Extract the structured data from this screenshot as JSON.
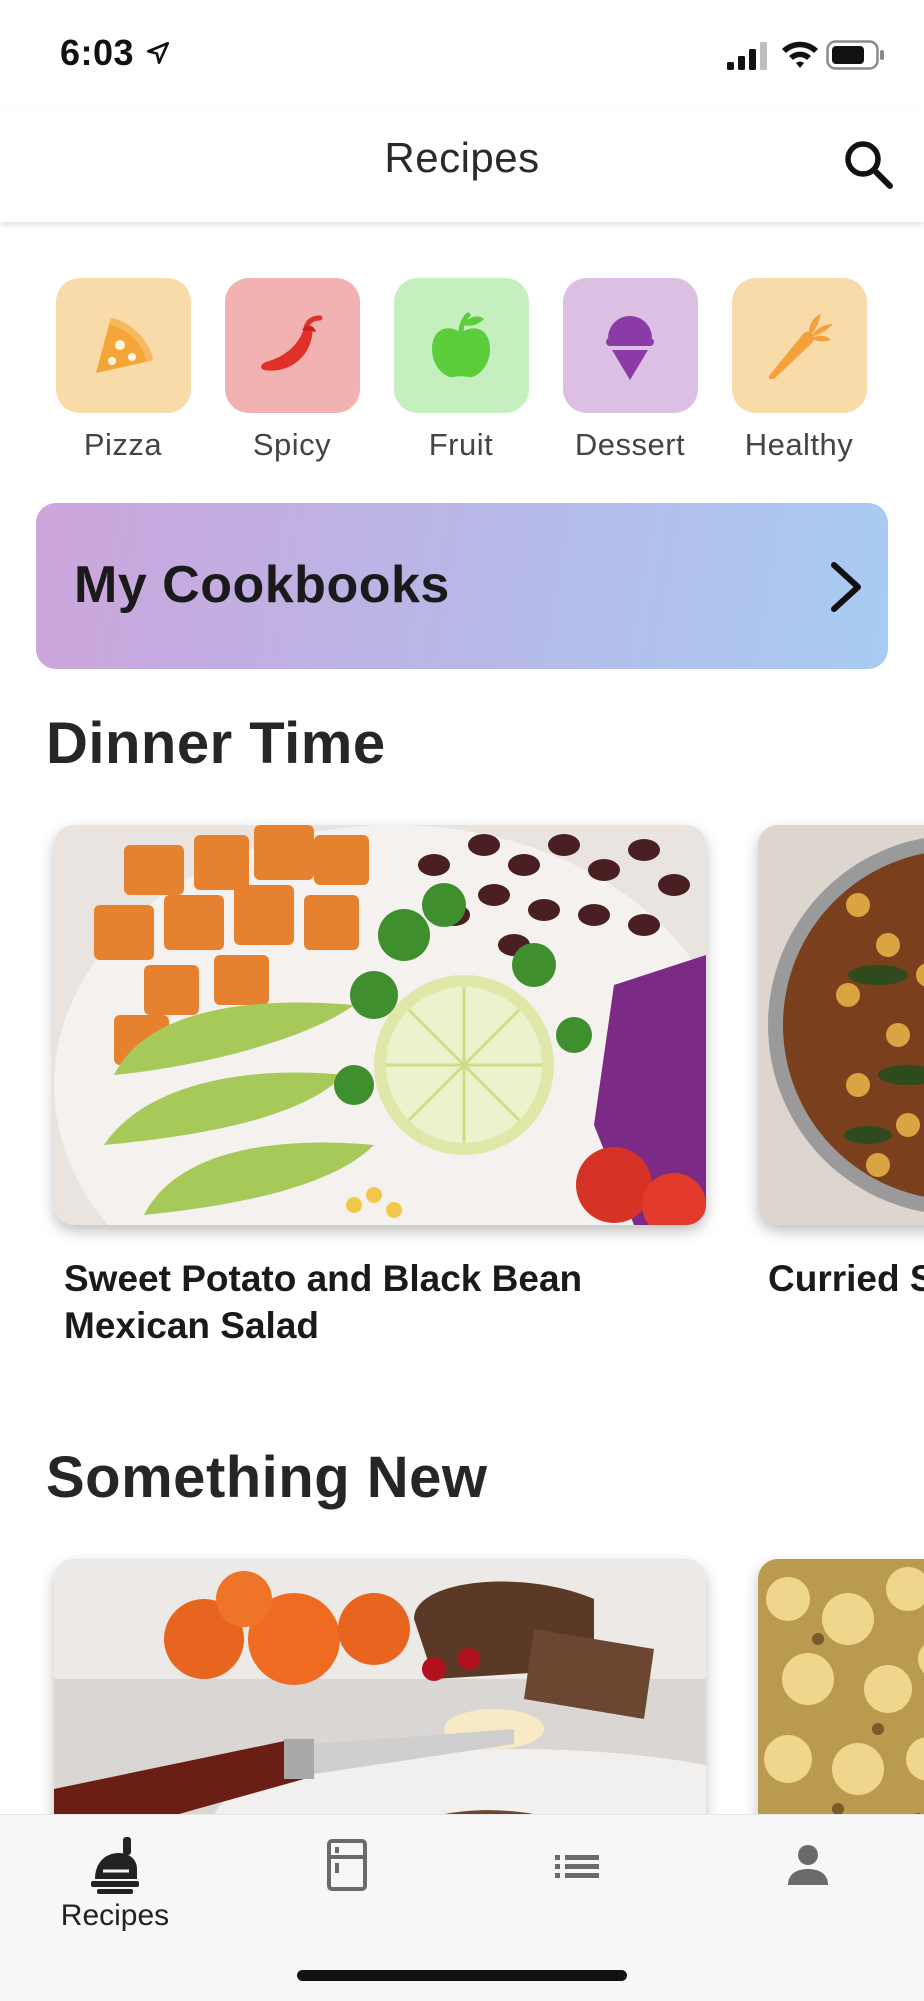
{
  "status_bar": {
    "time": "6:03"
  },
  "header": {
    "title": "Recipes"
  },
  "categories": [
    {
      "label": "Pizza",
      "color": "#f8dba8",
      "icon": "pizza-icon"
    },
    {
      "label": "Spicy",
      "color": "#f2b2b2",
      "icon": "chili-pepper-icon"
    },
    {
      "label": "Fruit",
      "color": "#c6efc0",
      "icon": "apple-icon"
    },
    {
      "label": "Dessert",
      "color": "#dcc0e4",
      "icon": "ice-cream-icon"
    },
    {
      "label": "Healthy",
      "color": "#f8dba8",
      "icon": "carrot-icon"
    }
  ],
  "cookbooks": {
    "label": "My Cookbooks"
  },
  "sections": [
    {
      "title": "Dinner Time",
      "cards": [
        {
          "title": "Sweet Potato and Black Bean Mexican Salad"
        },
        {
          "title": "Curried Spinach"
        }
      ]
    },
    {
      "title": "Something New",
      "cards": [
        {
          "title": ""
        },
        {
          "title": ""
        }
      ]
    }
  ],
  "tabbar": {
    "tabs": [
      {
        "label": "Recipes",
        "icon": "chef-hat-icon",
        "active": true
      },
      {
        "label": "",
        "icon": "fridge-icon",
        "active": false
      },
      {
        "label": "",
        "icon": "list-icon",
        "active": false
      },
      {
        "label": "",
        "icon": "person-icon",
        "active": false
      }
    ]
  },
  "colors": {
    "accent_gradient_start": "#cda5dc",
    "accent_gradient_end": "#a8ccf2",
    "pizza": "#f4a63b",
    "spicy": "#e0302a",
    "fruit": "#5ccd3a",
    "dessert": "#8a3ba6",
    "healthy": "#f4a03b"
  }
}
